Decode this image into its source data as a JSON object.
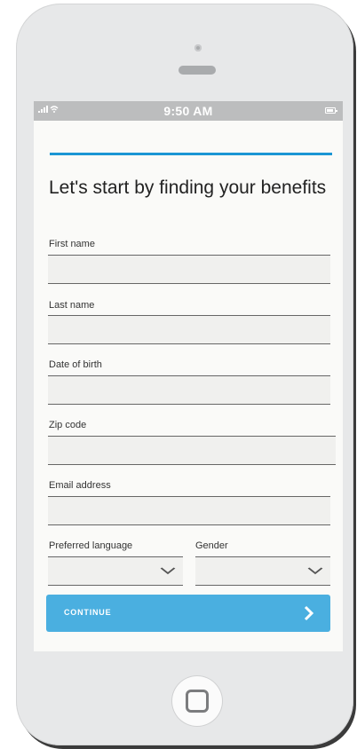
{
  "status_bar": {
    "signal": ".atll",
    "time": "9:50 AM"
  },
  "form": {
    "title": "Let's start by finding your benefits",
    "fields": {
      "first_name": {
        "label": "First name",
        "value": ""
      },
      "last_name": {
        "label": "Last name",
        "value": ""
      },
      "dob": {
        "label": "Date of birth",
        "value": ""
      },
      "zip": {
        "label": "Zip code",
        "value": ""
      },
      "email": {
        "label": "Email address",
        "value": ""
      },
      "language": {
        "label": "Preferred language",
        "value": ""
      },
      "gender": {
        "label": "Gender",
        "value": ""
      }
    },
    "continue_label": "CONTINUE"
  },
  "icons": {
    "signal": "signal-icon",
    "wifi": "wifi-icon",
    "battery": "battery-icon",
    "chevron": "chevron-down-icon",
    "arrow": "chevron-right-icon",
    "home": "home-button-icon"
  },
  "colors": {
    "progress": "#1b96d4",
    "button": "#4aafe0",
    "status_bar": "#bcbdbe"
  }
}
